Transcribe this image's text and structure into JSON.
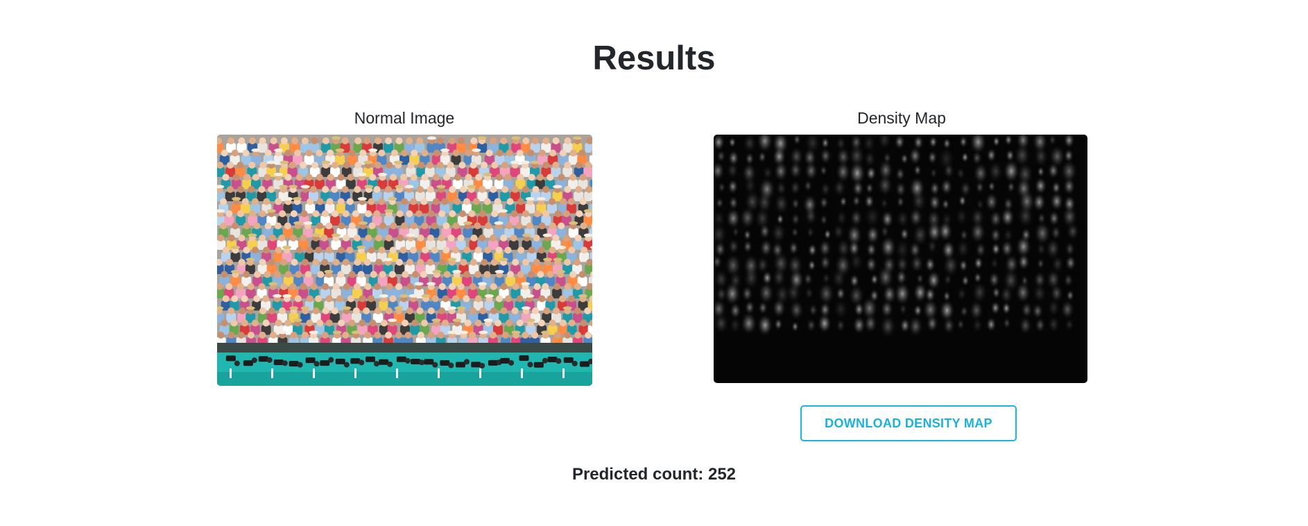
{
  "header": {
    "title": "Results"
  },
  "panels": {
    "normal": {
      "label": "Normal Image"
    },
    "density": {
      "label": "Density Map"
    }
  },
  "actions": {
    "download_label": "DOWNLOAD DENSITY MAP"
  },
  "result": {
    "label": "Predicted count:",
    "value": "252"
  },
  "colors": {
    "accent": "#1ab6e0",
    "text": "#23262b",
    "density_background": "#050505"
  }
}
